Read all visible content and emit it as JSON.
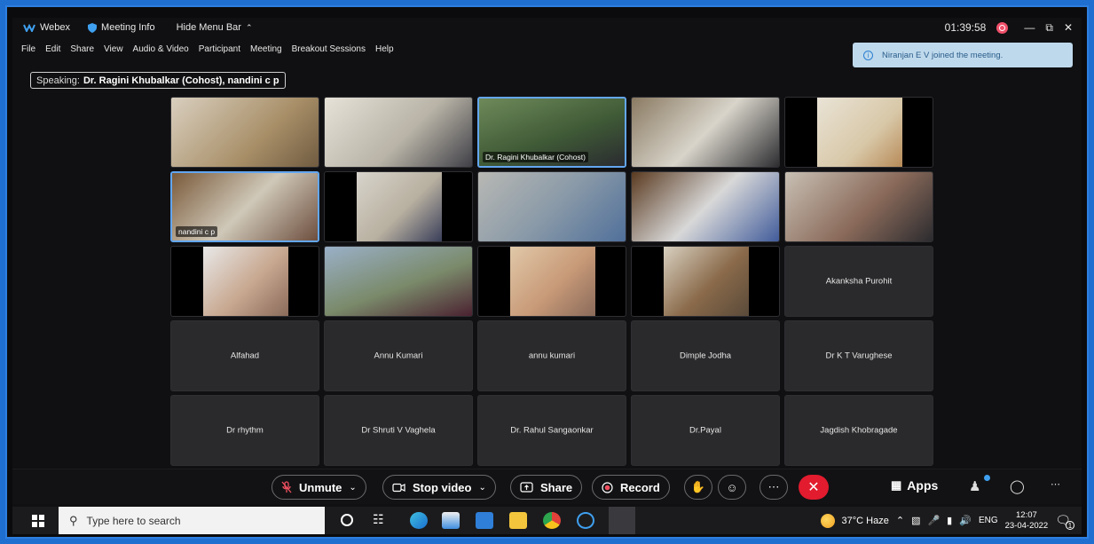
{
  "titlebar": {
    "app": "Webex",
    "meeting_info": "Meeting Info",
    "hide_menu": "Hide Menu Bar",
    "timer": "01:39:58",
    "minimize": "—",
    "restore": "⧉",
    "close": "✕"
  },
  "menu": [
    "File",
    "Edit",
    "Share",
    "View",
    "Audio & Video",
    "Participant",
    "Meeting",
    "Breakout Sessions",
    "Help"
  ],
  "toast": {
    "text": "Niranjan E V joined the meeting."
  },
  "speaking": {
    "label": "Speaking:",
    "names": "Dr. Ragini Khubalkar (Cohost), nandini c p"
  },
  "tiles": [
    {
      "type": "video",
      "name": ""
    },
    {
      "type": "video",
      "name": ""
    },
    {
      "type": "video",
      "name": "Dr. Ragini Khubalkar (Cohost)"
    },
    {
      "type": "video",
      "name": ""
    },
    {
      "type": "video",
      "name": ""
    },
    {
      "type": "video",
      "name": "nandini c p"
    },
    {
      "type": "video",
      "name": ""
    },
    {
      "type": "video",
      "name": ""
    },
    {
      "type": "video",
      "name": ""
    },
    {
      "type": "video",
      "name": ""
    },
    {
      "type": "video",
      "name": ""
    },
    {
      "type": "video",
      "name": ""
    },
    {
      "type": "video",
      "name": ""
    },
    {
      "type": "video",
      "name": ""
    },
    {
      "type": "name",
      "name": "Akanksha Purohit"
    },
    {
      "type": "name",
      "name": "Alfahad"
    },
    {
      "type": "name",
      "name": "Annu Kumari"
    },
    {
      "type": "name",
      "name": "annu kumari"
    },
    {
      "type": "name",
      "name": "Dimple Jodha"
    },
    {
      "type": "name",
      "name": "Dr K T Varughese"
    },
    {
      "type": "name",
      "name": "Dr rhythm"
    },
    {
      "type": "name",
      "name": "Dr Shruti V Vaghela"
    },
    {
      "type": "name",
      "name": "Dr. Rahul Sangaonkar"
    },
    {
      "type": "name",
      "name": "Dr.Payal"
    },
    {
      "type": "name",
      "name": "Jagdish Khobragade"
    }
  ],
  "toolbar": {
    "unmute": "Unmute",
    "stop_video": "Stop video",
    "share": "Share",
    "record": "Record",
    "apps": "Apps"
  },
  "taskbar": {
    "search_placeholder": "Type here to search",
    "weather": "37°C  Haze",
    "lang": "ENG",
    "time": "12:07",
    "date": "23-04-2022",
    "notif_count": "1"
  },
  "colors": {
    "accent": "#2d7fe0",
    "end_call": "#e21b2e",
    "toast_bg": "#bfd9ec"
  }
}
